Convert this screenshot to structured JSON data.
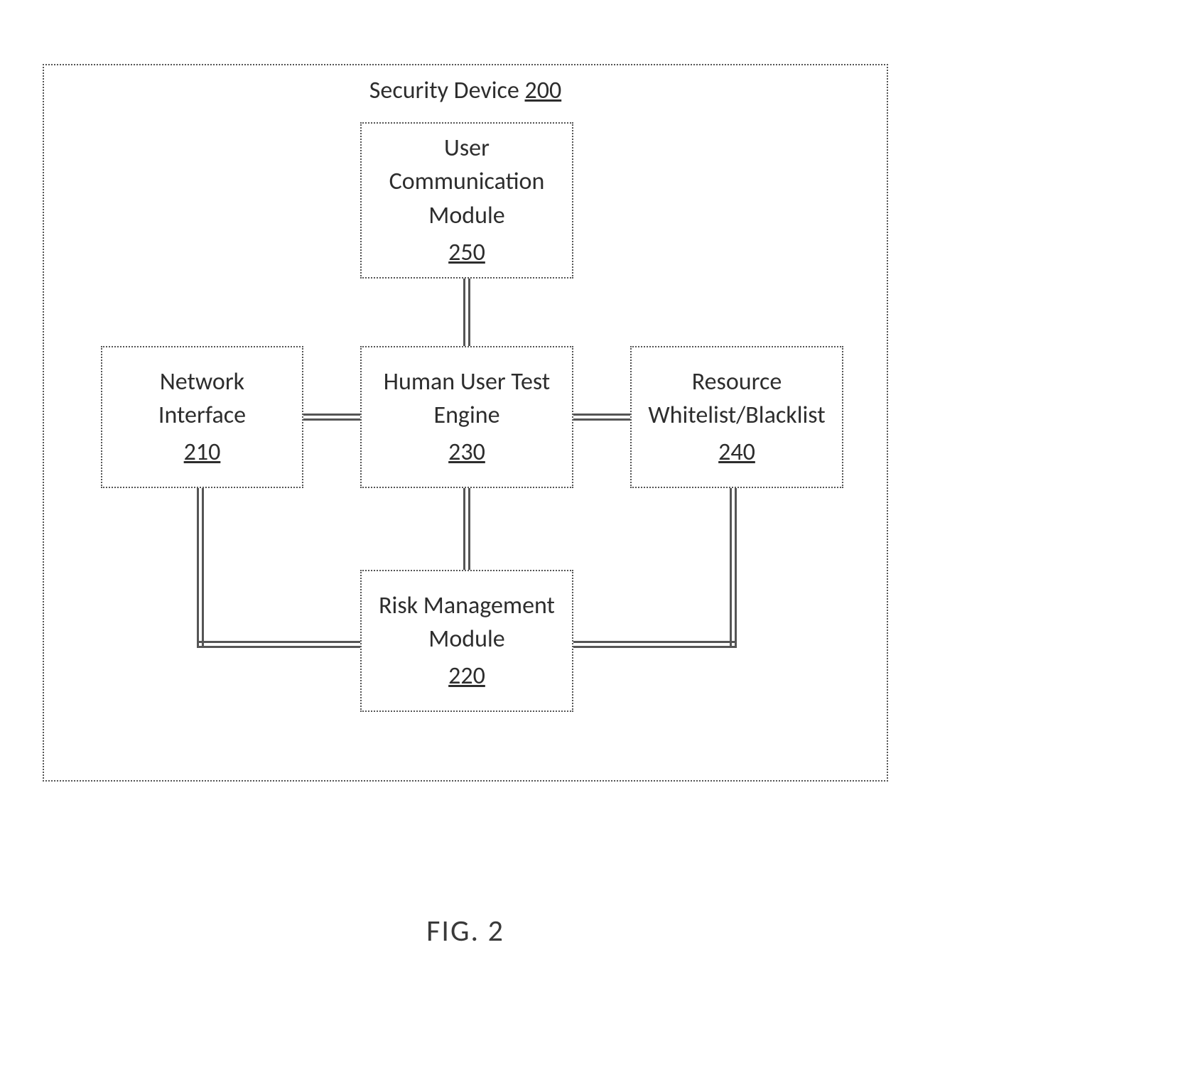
{
  "figure_caption": "FIG. 2",
  "container": {
    "title_prefix": "Security Device ",
    "number": "200"
  },
  "blocks": {
    "user_comm": {
      "line1": "User",
      "line2": "Communication",
      "line3": "Module",
      "number": "250"
    },
    "net_if": {
      "line1": "Network",
      "line2": "Interface",
      "number": "210"
    },
    "engine": {
      "line1": "Human User Test",
      "line2": "Engine",
      "number": "230"
    },
    "whitelist": {
      "line1": "Resource",
      "line2": "Whitelist/Blacklist",
      "number": "240"
    },
    "risk": {
      "line1": "Risk Management",
      "line2": "Module",
      "number": "220"
    }
  }
}
